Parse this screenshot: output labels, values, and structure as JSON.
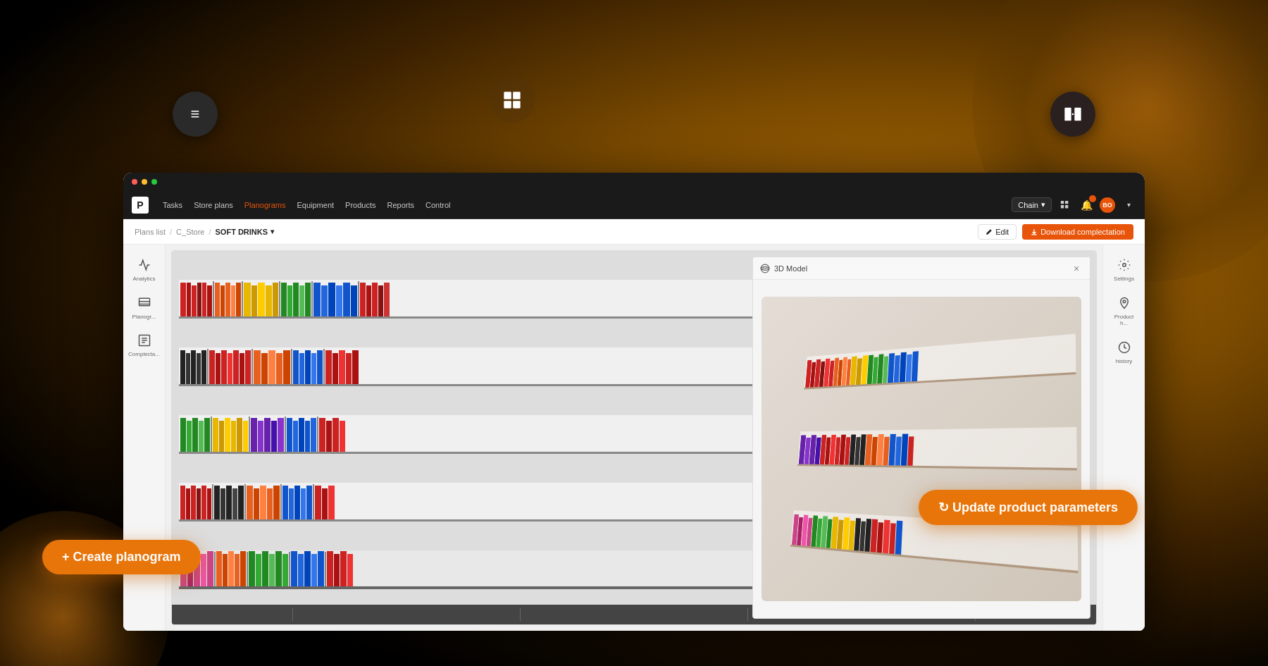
{
  "background": {
    "gradient_hint": "radial gold-brown on black"
  },
  "floating_buttons": {
    "menu_label": "≡",
    "grid_label": "⊞",
    "compare_label": "compare"
  },
  "browser": {
    "dots": [
      "red",
      "yellow",
      "green"
    ]
  },
  "navbar": {
    "logo": "P",
    "links": [
      {
        "label": "Tasks",
        "active": false
      },
      {
        "label": "Store plans",
        "active": false
      },
      {
        "label": "Planograms",
        "active": true
      },
      {
        "label": "Equipment",
        "active": false
      },
      {
        "label": "Products",
        "active": false
      },
      {
        "label": "Reports",
        "active": false
      },
      {
        "label": "Control",
        "active": false
      }
    ],
    "chain_select": "Chain",
    "avatar_text": "BO"
  },
  "breadcrumb": {
    "items": [
      "Plans list",
      "C_Store"
    ],
    "current": "SOFT DRINKS",
    "dropdown_arrow": "▾",
    "edit_label": "Edit",
    "download_label": "Download complectation"
  },
  "left_sidebar": {
    "items": [
      {
        "label": "Analytics",
        "icon": "chart"
      },
      {
        "label": "Planogr...",
        "icon": "planogram"
      },
      {
        "label": "Complecta...",
        "icon": "list"
      }
    ]
  },
  "right_sidebar": {
    "items": [
      {
        "label": "Settings",
        "icon": "settings"
      },
      {
        "label": "Product h...",
        "icon": "pin"
      },
      {
        "label": "history",
        "icon": "clock"
      }
    ]
  },
  "model_panel": {
    "title": "3D Model",
    "close_label": "×"
  },
  "fab_create": {
    "label": "+ Create planogram"
  },
  "fab_update": {
    "label": "↻ Update product parameters"
  }
}
